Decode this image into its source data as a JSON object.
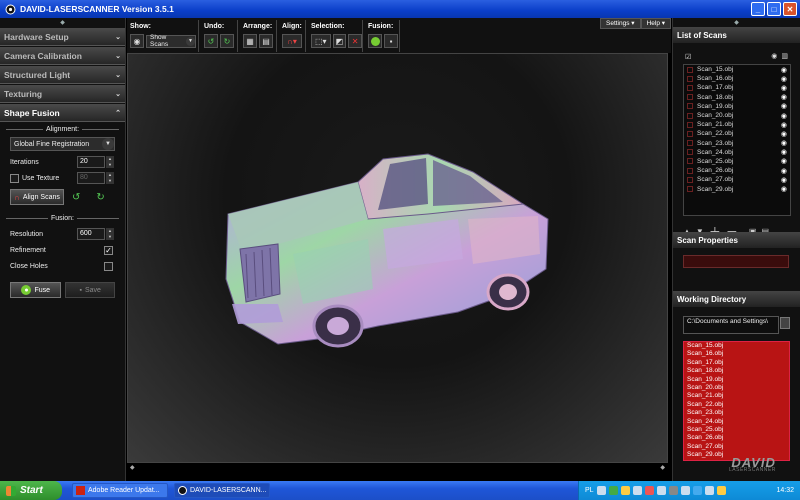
{
  "window": {
    "title": "DAVID-LASERSCANNER Version 3.5.1"
  },
  "left_panel": {
    "sections": [
      "Hardware Setup",
      "Camera Calibration",
      "Structured Light",
      "Texturing"
    ],
    "active_section": "Shape Fusion",
    "alignment": {
      "header": "Alignment:",
      "method": "Global Fine Registration",
      "iterations_label": "Iterations",
      "iterations_value": "20",
      "use_texture_label": "Use Texture",
      "use_texture_value": "80",
      "align_button": "Align Scans"
    },
    "fusion": {
      "header": "Fusion:",
      "resolution_label": "Resolution",
      "resolution_value": "600",
      "refinement_label": "Refinement",
      "refinement_checked": true,
      "close_holes_label": "Close Holes",
      "close_holes_checked": false,
      "fuse_button": "Fuse",
      "save_button": "Save"
    }
  },
  "toolbar": {
    "show_label": "Show:",
    "show_value": "Show Scans",
    "undo_label": "Undo:",
    "arrange_label": "Arrange:",
    "align_label": "Align:",
    "selection_label": "Selection:",
    "fusion_label": "Fusion:",
    "settings_menu": "Settings ▾",
    "help_menu": "Help ▾"
  },
  "right_panel": {
    "list_title": "List of Scans",
    "scans": [
      "Scan_15.obj",
      "Scan_16.obj",
      "Scan_17.obj",
      "Scan_18.obj",
      "Scan_19.obj",
      "Scan_20.obj",
      "Scan_21.obj",
      "Scan_22.obj",
      "Scan_23.obj",
      "Scan_24.obj",
      "Scan_25.obj",
      "Scan_26.obj",
      "Scan_27.obj",
      "Scan_29.obj"
    ],
    "properties_title": "Scan Properties",
    "working_dir_title": "Working Directory",
    "working_dir_path": "C:\\Documents and Settings\\",
    "dir_files": [
      "Scan_15.obj",
      "Scan_16.obj",
      "Scan_17.obj",
      "Scan_18.obj",
      "Scan_19.obj",
      "Scan_20.obj",
      "Scan_21.obj",
      "Scan_22.obj",
      "Scan_23.obj",
      "Scan_24.obj",
      "Scan_25.obj",
      "Scan_26.obj",
      "Scan_27.obj",
      "Scan_29.obj"
    ],
    "brand_main": "DAVID",
    "brand_sub": "LASERSCANNER"
  },
  "taskbar": {
    "start": "Start",
    "tasks": [
      "Adobe Reader Updat...",
      "DAVID-LASERSCANN..."
    ],
    "lang": "PL",
    "clock": "14:32"
  },
  "colors": {
    "accent_red": "#b81414",
    "title_blue": "#0a3ec8"
  }
}
